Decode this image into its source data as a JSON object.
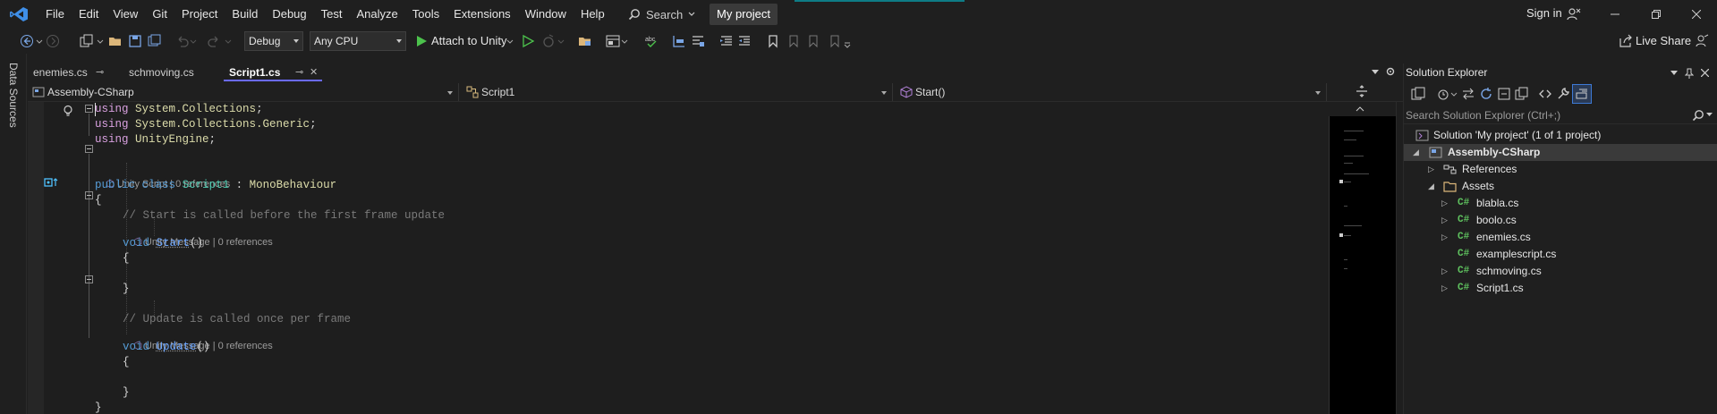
{
  "menu": {
    "items": [
      "File",
      "Edit",
      "View",
      "Git",
      "Project",
      "Build",
      "Debug",
      "Test",
      "Analyze",
      "Tools",
      "Extensions",
      "Window",
      "Help"
    ],
    "search_label": "Search",
    "project_name": "My project",
    "signin_label": "Sign in"
  },
  "toolbar": {
    "config": "Debug",
    "platform": "Any CPU",
    "attach_label": "Attach to Unity",
    "live_share_label": "Live Share"
  },
  "left_rail": {
    "label": "Data Sources"
  },
  "tabs": [
    {
      "label": "enemies.cs",
      "active": false
    },
    {
      "label": "schmoving.cs",
      "active": false
    },
    {
      "label": "Script1.cs",
      "active": true
    }
  ],
  "navbar": {
    "project": "Assembly-CSharp",
    "type": "Script1",
    "member": "Start()"
  },
  "code": {
    "using1_ns": "System.Collections",
    "using2_ns": "System.Collections.Generic",
    "using3_ns": "UnityEngine",
    "lens_class": "Unity Script | 0 references",
    "class_name": "Script1",
    "base_class": "MonoBehaviour",
    "comment_start": "// Start is called before the first frame update",
    "lens_start": "Unity Message | 0 references",
    "method_start": "Start",
    "comment_update": "// Update is called once per frame",
    "lens_update": "Unity Message | 0 references",
    "method_update": "Update"
  },
  "solution_explorer": {
    "title": "Solution Explorer",
    "search_placeholder": "Search Solution Explorer (Ctrl+;)",
    "solution_label": "Solution 'My project' (1 of 1 project)",
    "project_label": "Assembly-CSharp",
    "references_label": "References",
    "assets_label": "Assets",
    "files": [
      "blabla.cs",
      "boolo.cs",
      "enemies.cs",
      "examplescript.cs",
      "schmoving.cs",
      "Script1.cs"
    ]
  }
}
